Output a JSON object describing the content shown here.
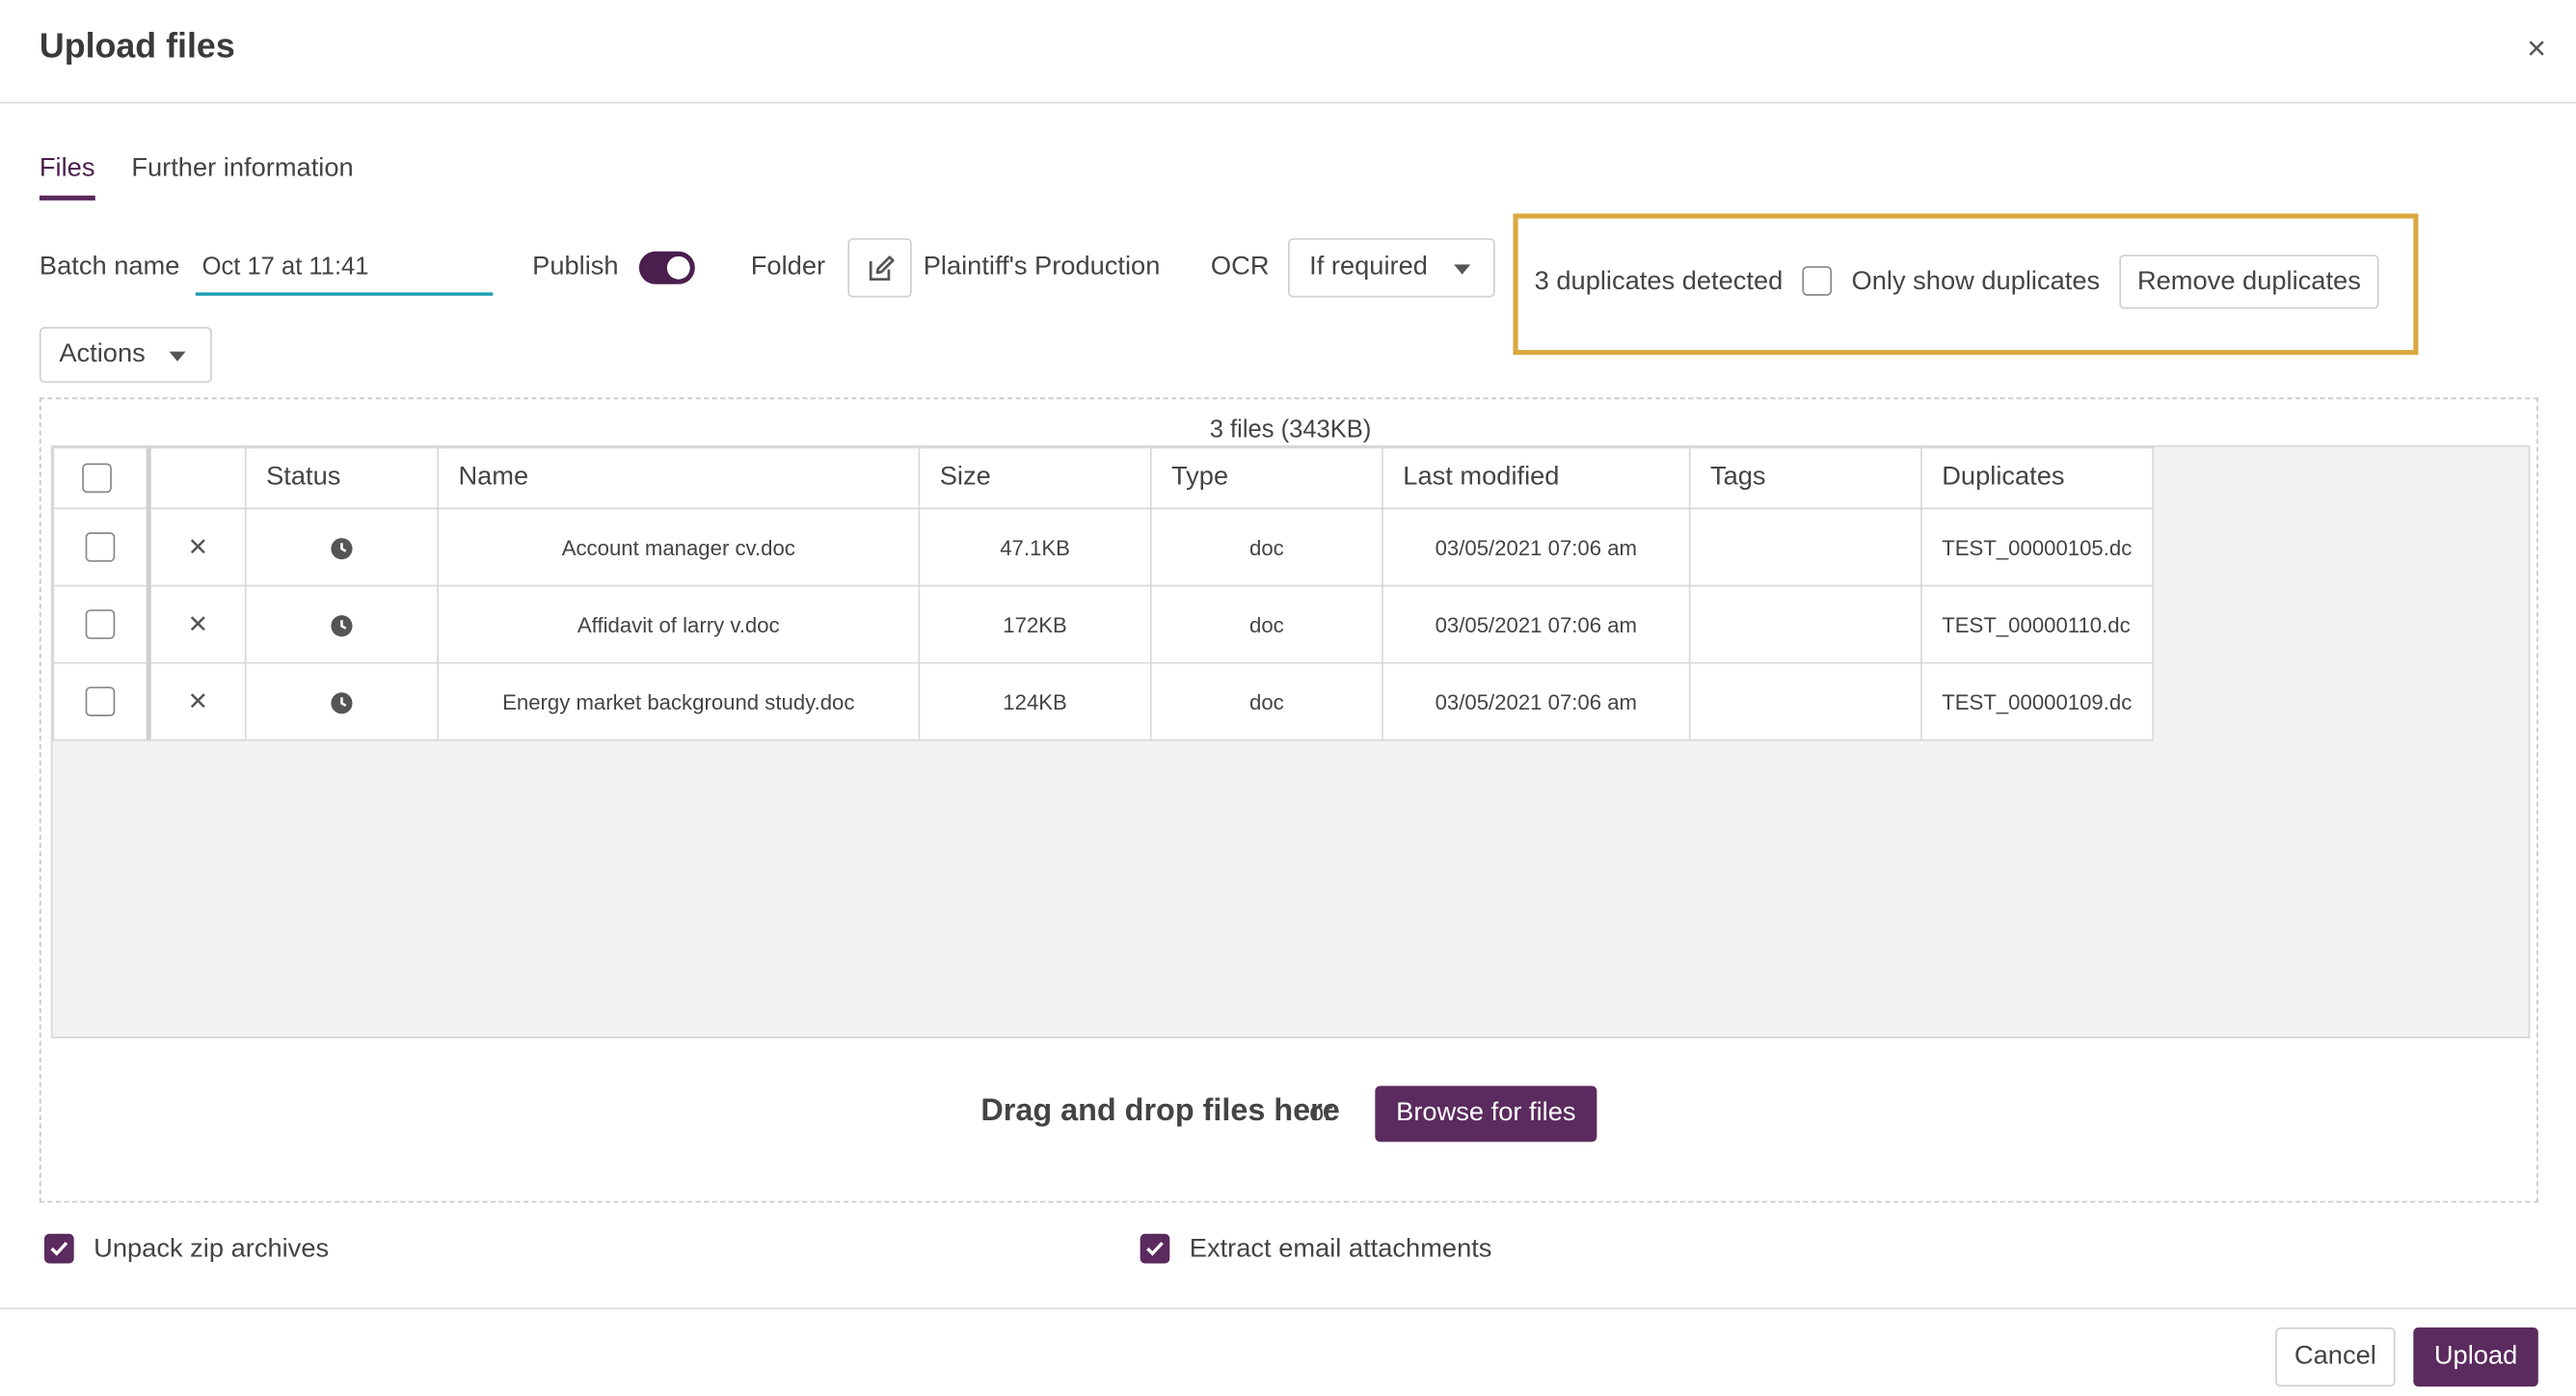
{
  "dialog": {
    "title": "Upload files",
    "close_label": "×"
  },
  "tabs": [
    {
      "label": "Files",
      "active": true
    },
    {
      "label": "Further information",
      "active": false
    }
  ],
  "batch": {
    "label": "Batch name",
    "value": "Oct 17 at 11:41"
  },
  "publish": {
    "label": "Publish",
    "on": true
  },
  "folder": {
    "label": "Folder",
    "value": "Plaintiff's Production"
  },
  "ocr": {
    "label": "OCR",
    "value": "If required"
  },
  "duplicates": {
    "detected_text": "3 duplicates detected",
    "only_show_label": "Only show duplicates",
    "remove_label": "Remove duplicates"
  },
  "actions": {
    "label": "Actions"
  },
  "files": {
    "summary": "3 files (343KB)",
    "columns": [
      "Status",
      "Name",
      "Size",
      "Type",
      "Last modified",
      "Tags",
      "Duplicates"
    ],
    "rows": [
      {
        "name": "Account manager cv.doc",
        "size": "47.1KB",
        "type": "doc",
        "modified": "03/05/2021 07:06 am",
        "tags": "",
        "duplicates": "TEST_00000105.dc"
      },
      {
        "name": "Affidavit of larry v.doc",
        "size": "172KB",
        "type": "doc",
        "modified": "03/05/2021 07:06 am",
        "tags": "",
        "duplicates": "TEST_00000110.dc"
      },
      {
        "name": "Energy market background study.doc",
        "size": "124KB",
        "type": "doc",
        "modified": "03/05/2021 07:06 am",
        "tags": "",
        "duplicates": "TEST_00000109.dc"
      }
    ]
  },
  "dropzone": {
    "text": "Drag and drop files here",
    "or": "or",
    "browse_label": "Browse for files"
  },
  "options": {
    "unpack_zip": "Unpack zip archives",
    "extract_email": "Extract email attachments"
  },
  "footer": {
    "cancel_label": "Cancel",
    "upload_label": "Upload"
  },
  "colors": {
    "accent": "#5b2a5e",
    "highlight": "#d9a93f",
    "input_underline": "#1a9fb0"
  }
}
